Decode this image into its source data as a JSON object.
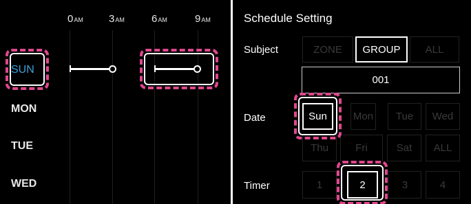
{
  "left": {
    "hours": [
      {
        "num": "0",
        "suffix": "AM"
      },
      {
        "num": "3",
        "suffix": "AM"
      },
      {
        "num": "6",
        "suffix": "AM"
      },
      {
        "num": "9",
        "suffix": "AM"
      }
    ],
    "days": [
      "SUN",
      "MON",
      "TUE",
      "WED"
    ],
    "active_day": "SUN"
  },
  "right": {
    "title": "Schedule Setting",
    "labels": {
      "subject": "Subject",
      "date": "Date",
      "timer": "Timer"
    },
    "subject_options": [
      "ZONE",
      "GROUP",
      "ALL"
    ],
    "subject_selected": "GROUP",
    "group_value": "001",
    "date_row1": [
      "Sun",
      "Mon",
      "Tue",
      "Wed"
    ],
    "date_row2": [
      "Thu",
      "Fri",
      "Sat",
      "ALL"
    ],
    "date_selected": "Sun",
    "timer_options": [
      "1",
      "2",
      "3",
      "4"
    ],
    "timer_selected": "2"
  },
  "colors": {
    "highlight": "#e0478e",
    "active_day": "#3aa0dc"
  }
}
